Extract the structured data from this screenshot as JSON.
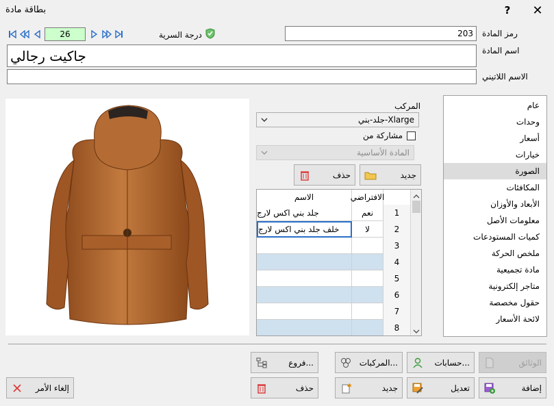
{
  "window": {
    "title": "بطاقة مادة",
    "help": "?",
    "close": "✕"
  },
  "nav": {
    "page": "26",
    "security_label": "درجة السرية"
  },
  "fields": {
    "code_label": "رمز المادة",
    "code_value": "203",
    "name_label": "اسم المادة",
    "name_value": "جاكيت رجالي",
    "latin_label": "الاسم اللاتيني",
    "latin_value": ""
  },
  "composite": {
    "label": "المركب",
    "value": "جلد-بني-Xlarge",
    "share_label": "مشاركة من",
    "base_item": "المادة الأساسية"
  },
  "image_buttons": {
    "new": "جديد",
    "delete": "حذف"
  },
  "grid": {
    "col_default": "الافتراضي",
    "col_name": "الاسم",
    "rows": [
      {
        "n": "1",
        "default": "نعم",
        "name": "جلد بني اكس لارج"
      },
      {
        "n": "2",
        "default": "لا",
        "name": "خلف جلد بني اكس لارج"
      },
      {
        "n": "3",
        "default": "",
        "name": ""
      },
      {
        "n": "4",
        "default": "",
        "name": ""
      },
      {
        "n": "5",
        "default": "",
        "name": ""
      },
      {
        "n": "6",
        "default": "",
        "name": ""
      },
      {
        "n": "7",
        "default": "",
        "name": ""
      },
      {
        "n": "8",
        "default": "",
        "name": ""
      }
    ]
  },
  "side_menu": [
    "عام",
    "وحدات",
    "أسعار",
    "خيارات",
    "الصورة",
    "المكافئات",
    "الأبعاد والأوزان",
    "معلومات الأصل",
    "كميات المستودعات",
    "ملخص الحركة",
    "مادة تجميعية",
    "متاجر إلكترونية",
    "حقول مخصصة",
    "لائحة الأسعار"
  ],
  "side_selected": 4,
  "buttons": {
    "documents": "الوثائق",
    "accounts": "حسابات...",
    "composites": "المركبات...",
    "branches": "فروع...",
    "add": "إضافة",
    "edit": "تعديل",
    "new": "جديد",
    "delete": "حذف",
    "cancel": "إلغاء الأمر"
  },
  "colors": {
    "selected_row": "#dcdcdc",
    "alt_row": "#cfe0ef",
    "page_box": "#ccffcc",
    "leather": "#b5672e"
  }
}
